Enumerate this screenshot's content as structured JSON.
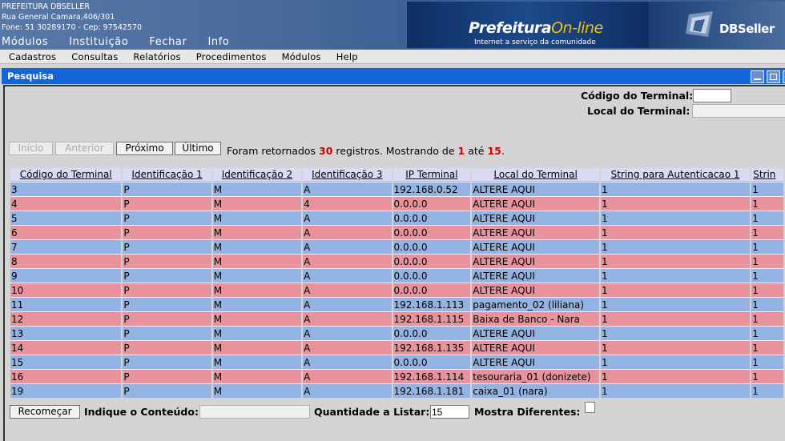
{
  "header": {
    "company_name": "PREFEITURA DBSELLER",
    "address": "Rua General Camara,406/301",
    "contact": "Fone: 51 30289170  -  Cep: 97542570",
    "topnav": [
      "Módulos",
      "Instituição",
      "Fechar",
      "Info"
    ],
    "banner": {
      "brand": "Prefeitura",
      "brand_accent": "On-line",
      "tagline": "Internet a serviço da comunidade"
    },
    "logo_text": "DBSeller"
  },
  "menu": [
    "Cadastros",
    "Consultas",
    "Relatórios",
    "Procedimentos",
    "Módulos",
    "Help"
  ],
  "window": {
    "title": "Pesquisa"
  },
  "filters": {
    "codigo_label": "Código do Terminal:",
    "codigo_value": "",
    "local_label": "Local do Terminal:",
    "local_value": ""
  },
  "pager": {
    "first": "Início",
    "prev": "Anterior",
    "next": "Próximo",
    "last": "Último",
    "msg_prefix": "Foram retornados",
    "total": "30",
    "msg_mid": "registros. Mostrando de",
    "from": "1",
    "msg_ate": "até",
    "to": "15",
    "msg_end": "."
  },
  "table": {
    "columns": [
      "Código do Terminal",
      "Identificação 1",
      "Identificação 2",
      "Identificação 3",
      "IP Terminal",
      "Local do Terminal",
      "String para Autenticacao 1",
      "Strin"
    ],
    "rows": [
      [
        "3",
        "P",
        "M",
        "A",
        "192.168.0.52",
        "ALTERE AQUI",
        "1",
        "1"
      ],
      [
        "4",
        "P",
        "M",
        "4",
        "0.0.0.0",
        "ALTERE AQUI",
        "1",
        "1"
      ],
      [
        "5",
        "P",
        "M",
        "A",
        "0.0.0.0",
        "ALTERE AQUI",
        "1",
        "1"
      ],
      [
        "6",
        "P",
        "M",
        "A",
        "0.0.0.0",
        "ALTERE AQUI",
        "1",
        "1"
      ],
      [
        "7",
        "P",
        "M",
        "A",
        "0.0.0.0",
        "ALTERE AQUI",
        "1",
        "1"
      ],
      [
        "8",
        "P",
        "M",
        "A",
        "0.0.0.0",
        "ALTERE AQUI",
        "1",
        "1"
      ],
      [
        "9",
        "P",
        "M",
        "A",
        "0.0.0.0",
        "ALTERE AQUI",
        "1",
        "1"
      ],
      [
        "10",
        "P",
        "M",
        "A",
        "0.0.0.0",
        "ALTERE AQUI",
        "1",
        "1"
      ],
      [
        "11",
        "P",
        "M",
        "A",
        "192.168.1.113",
        "pagamento_02 (liliana)",
        "1",
        "1"
      ],
      [
        "12",
        "P",
        "M",
        "A",
        "192.168.1.115",
        "Baixa de Banco - Nara",
        "1",
        "1"
      ],
      [
        "13",
        "P",
        "M",
        "A",
        "0.0.0.0",
        "ALTERE AQUI",
        "1",
        "1"
      ],
      [
        "14",
        "P",
        "M",
        "A",
        "192.168.1.135",
        "ALTERE AQUI",
        "1",
        "1"
      ],
      [
        "15",
        "P",
        "M",
        "A",
        "0.0.0.0",
        "ALTERE AQUI",
        "1",
        "1"
      ],
      [
        "16",
        "P",
        "M",
        "A",
        "192.168.1.114",
        "tesouraria_01 (donizete)",
        "1",
        "1"
      ],
      [
        "19",
        "P",
        "M",
        "A",
        "192.168.1.181",
        "caixa_01 (nara)",
        "1",
        "1"
      ]
    ]
  },
  "bottom": {
    "restart": "Recomeçar",
    "content_label": "Indique o Conteúdo:",
    "content_value": "",
    "qty_label": "Quantidade a Listar:",
    "qty_value": "15",
    "diff_label": "Mostra Diferentes:"
  },
  "colors": {
    "titlebar": "#1563d8",
    "row_odd": "#93b3e2",
    "row_even": "#e8939c",
    "highlight": "#d00000"
  }
}
